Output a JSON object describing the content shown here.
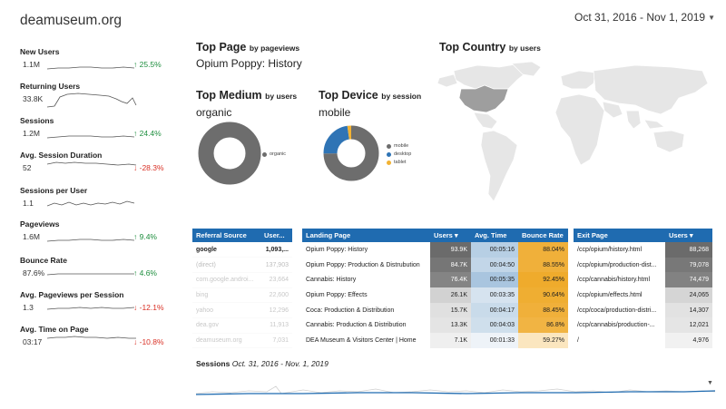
{
  "site_title": "deamuseum.org",
  "date_range": {
    "label": "Oct 31, 2016 - Nov 1, 2019",
    "caret": "▼"
  },
  "metrics": [
    {
      "label": "New Users",
      "value": "1.1M",
      "change": "↑ 25.5%",
      "dir": "up"
    },
    {
      "label": "Returning Users",
      "value": "33.8K",
      "change": "",
      "dir": "none"
    },
    {
      "label": "Sessions",
      "value": "1.2M",
      "change": "↑ 24.4%",
      "dir": "up"
    },
    {
      "label": "Avg. Session Duration",
      "value": "52",
      "change": "↓ -28.3%",
      "dir": "down"
    },
    {
      "label": "Sessions per User",
      "value": "1.1",
      "change": "",
      "dir": "none"
    },
    {
      "label": "Pageviews",
      "value": "1.6M",
      "change": "↑ 9.4%",
      "dir": "up"
    },
    {
      "label": "Bounce Rate",
      "value": "87.6%",
      "change": "↑ 4.6%",
      "dir": "up"
    },
    {
      "label": "Avg. Pageviews per Session",
      "value": "1.3",
      "change": "↓ -12.1%",
      "dir": "down"
    },
    {
      "label": "Avg. Time on Page",
      "value": "03:17",
      "change": "↓ -10.8%",
      "dir": "down"
    }
  ],
  "top_page": {
    "title": "Top Page",
    "suffix": "by pageviews",
    "value": "Opium Poppy: History"
  },
  "top_country": {
    "title": "Top Country",
    "suffix": "by users"
  },
  "top_medium": {
    "title": "Top Medium",
    "suffix": "by users",
    "value": "organic",
    "legend": [
      "organic"
    ]
  },
  "top_device": {
    "title": "Top Device",
    "suffix": "by session",
    "value": "mobile",
    "legend": [
      "mobile",
      "desktop",
      "tablet"
    ]
  },
  "colors": {
    "header_blue": "#1f6bb0",
    "bounce_orange": "#f0b03a",
    "donut_gray": "#6d6d6d",
    "device_blue": "#2f74b5",
    "device_yellow": "#f2b233"
  },
  "referral": {
    "headers": [
      "Referral Source",
      "User..."
    ],
    "rows": [
      [
        "google",
        "1,093,..."
      ],
      [
        "(direct)",
        "137,903"
      ],
      [
        "com.google.androi...",
        "23,664"
      ],
      [
        "bing",
        "22,600"
      ],
      [
        "yahoo",
        "12,296"
      ],
      [
        "dea.gov",
        "11,913"
      ],
      [
        "deamuseum.org",
        "7,031"
      ]
    ]
  },
  "landing": {
    "headers": [
      "Landing Page",
      "Users ▾",
      "Avg. Time",
      "Bounce Rate"
    ],
    "rows": [
      [
        "Opium Poppy: History",
        "93.9K",
        "00:05:16",
        "88.04%"
      ],
      [
        "Opium Poppy: Production & Distrubution",
        "84.7K",
        "00:04:50",
        "88.55%"
      ],
      [
        "Cannabis: History",
        "76.4K",
        "00:05:35",
        "92.45%"
      ],
      [
        "Opium Poppy: Effects",
        "26.1K",
        "00:03:35",
        "90.64%"
      ],
      [
        "Coca: Production & Distribution",
        "15.7K",
        "00:04:17",
        "88.45%"
      ],
      [
        "Cannabis: Production & Distribution",
        "13.3K",
        "00:04:03",
        "86.8%"
      ],
      [
        "DEA Museum & Visitors Center | Home",
        "7.1K",
        "00:01:33",
        "59.27%"
      ]
    ]
  },
  "exit": {
    "headers": [
      "Exit Page",
      "Users ▾"
    ],
    "rows": [
      [
        "/ccp/opium/history.html",
        "88,268"
      ],
      [
        "/ccp/opium/production-dist...",
        "79,078"
      ],
      [
        "/ccp/cannabis/history.html",
        "74,479"
      ],
      [
        "/ccp/opium/effects.html",
        "24,065"
      ],
      [
        "/ccp/coca/production-distri...",
        "14,307"
      ],
      [
        "/ccp/cannabis/production-...",
        "12,021"
      ],
      [
        "/",
        "4,976"
      ]
    ]
  },
  "sessions_chart": {
    "title": "Sessions",
    "subtitle": "Oct. 31, 2016 - Nov. 1, 2019"
  }
}
